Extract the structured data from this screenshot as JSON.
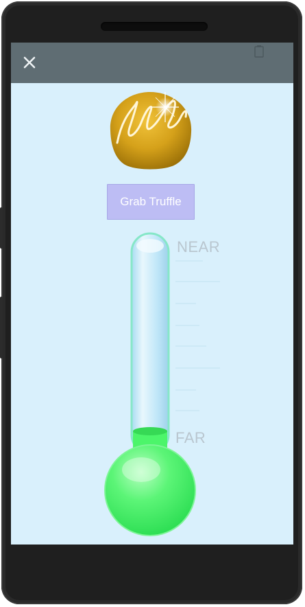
{
  "app": {
    "close_icon": "close-icon",
    "status_icon": "battery-icon"
  },
  "main": {
    "truffle_image": "chocolate-truffle",
    "grab_button_label": "Grab Truffle"
  },
  "thermometer": {
    "top_label": "NEAR",
    "bottom_label": "FAR",
    "level_fraction": 0.0,
    "liquid_color": "#4cf56a",
    "tube_color": "#bfe6f8"
  },
  "colors": {
    "screen_bg": "#d9f0fc",
    "appbar_bg": "#5f6d73",
    "button_bg": "#bdbdf4",
    "truffle": "#d9a21e"
  }
}
